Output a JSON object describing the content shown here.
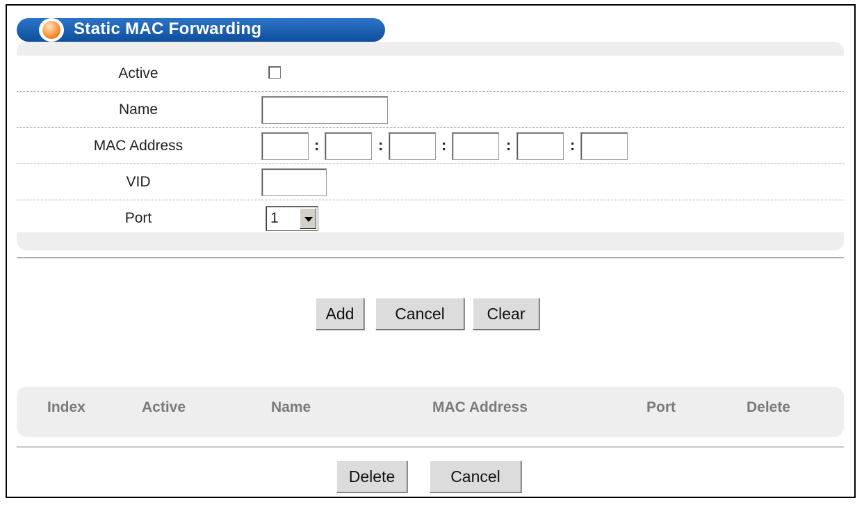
{
  "header": {
    "title": "Static MAC Forwarding"
  },
  "form": {
    "active_label": "Active",
    "active_checked": false,
    "name_label": "Name",
    "name_value": "",
    "mac_label": "MAC Address",
    "mac_separator": ":",
    "mac_octets": [
      "",
      "",
      "",
      "",
      "",
      ""
    ],
    "vid_label": "VID",
    "vid_value": "",
    "port_label": "Port",
    "port_selected": "1"
  },
  "form_actions": {
    "add": "Add",
    "cancel": "Cancel",
    "clear": "Clear"
  },
  "list": {
    "columns": [
      "Index",
      "Active",
      "Name",
      "MAC Address",
      "Port",
      "Delete"
    ],
    "rows": []
  },
  "list_actions": {
    "delete": "Delete",
    "cancel": "Cancel"
  },
  "colors": {
    "banner": "#1a5fb4",
    "panel": "#eeeeee",
    "header_text": "#7a7a7a"
  },
  "icons": {
    "title_bullet": "orange-orb-icon",
    "select_arrow": "chevron-down-icon"
  }
}
